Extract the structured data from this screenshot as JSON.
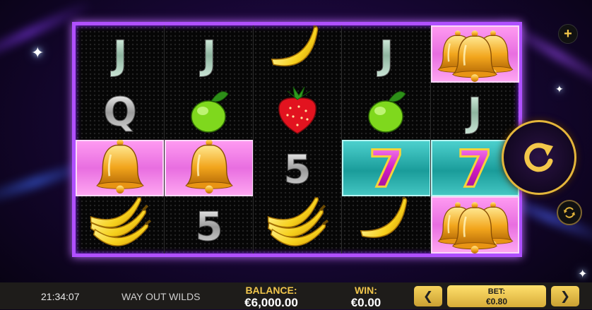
{
  "colors": {
    "frame": "#b050ff",
    "reel_bg": "#060606",
    "pink_highlight": "#e86ee0",
    "teal_highlight": "#1a9c9a",
    "gold": "#f1c64c",
    "bottom_bar": "#1e1c1a"
  },
  "reels": [
    {
      "symbols": [
        "J",
        "Q",
        "bell",
        "banana-bunch"
      ]
    },
    {
      "symbols": [
        "J",
        "lime",
        "bell",
        "5"
      ]
    },
    {
      "symbols": [
        "banana",
        "strawberry",
        "5",
        "banana-bunch"
      ]
    },
    {
      "symbols": [
        "J",
        "lime",
        "seven",
        "banana"
      ]
    },
    {
      "symbols": [
        "bell-triple",
        "J",
        "seven",
        "bell-triple"
      ]
    }
  ],
  "highlighted_cells": {
    "pink": [
      [
        0,
        2
      ],
      [
        1,
        2
      ],
      [
        4,
        0
      ],
      [
        4,
        3
      ]
    ],
    "teal": [
      [
        3,
        2
      ],
      [
        4,
        2
      ]
    ]
  },
  "controls": {
    "plus_icon": "plus-icon",
    "spin_icon": "spin-arrow-icon",
    "autoplay_icon": "autoplay-icon"
  },
  "status_bar": {
    "clock": "21:34:07",
    "game_name": "WAY OUT WILDS",
    "balance_label": "BALANCE:",
    "balance_value": "€6,000.00",
    "win_label": "WIN:",
    "win_value": "€0.00",
    "bet_label": "BET:",
    "bet_value": "€0.80",
    "prev_arrow": "❮",
    "next_arrow": "❯"
  }
}
